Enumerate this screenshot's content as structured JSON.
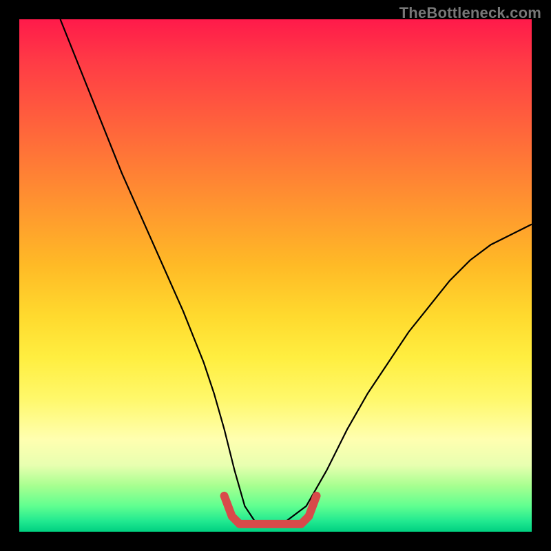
{
  "watermark": "TheBottleneck.com",
  "chart_data": {
    "type": "line",
    "title": "",
    "xlabel": "",
    "ylabel": "",
    "xlim": [
      0,
      100
    ],
    "ylim": [
      0,
      100
    ],
    "series": [
      {
        "name": "black-curve",
        "color": "#000000",
        "x": [
          8,
          12,
          16,
          20,
          24,
          28,
          32,
          36,
          38,
          40,
          42,
          44,
          46,
          48,
          52,
          56,
          60,
          64,
          68,
          72,
          76,
          80,
          84,
          88,
          92,
          96,
          100
        ],
        "y": [
          100,
          90,
          80,
          70,
          61,
          52,
          43,
          33,
          27,
          20,
          12,
          5,
          2,
          2,
          2,
          5,
          12,
          20,
          27,
          33,
          39,
          44,
          49,
          53,
          56,
          58,
          60
        ]
      },
      {
        "name": "highlight-bracket",
        "color": "#d84a4a",
        "x": [
          40,
          41.5,
          43,
          50,
          55,
          56.5,
          58
        ],
        "y": [
          7,
          3,
          1.5,
          1.5,
          1.5,
          3,
          7
        ]
      }
    ]
  }
}
